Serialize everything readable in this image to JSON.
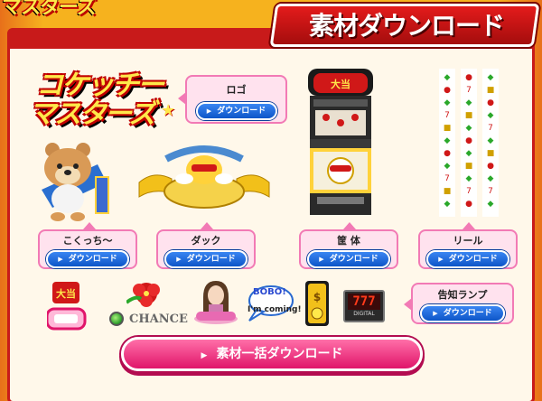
{
  "header": {
    "top_logo_text": "マスターズ",
    "title": "素材ダウンロード"
  },
  "logo_art": {
    "line1": "コケッチー",
    "line2": "マスターズ"
  },
  "download_label": "ダウンロード",
  "items": [
    {
      "label": "ロゴ"
    },
    {
      "label": "こくっち〜"
    },
    {
      "label": "ダック"
    },
    {
      "label": "筐 体"
    },
    {
      "label": "リール"
    },
    {
      "label": "告知ランプ"
    }
  ],
  "small_icons": {
    "chance": "CHANCE",
    "bobo_line1": "BOBO!",
    "bobo_line2": "I'm coming!",
    "digital_counter": "777",
    "digital_label": "DIGITAL"
  },
  "bulk_download_label": "素材一括ダウンロード",
  "colors": {
    "accent_red": "#c81a1a",
    "button_blue": "#0d55c8",
    "bubble_pink": "#ffe2ee",
    "bulk_pink": "#e0156a",
    "background_orange": "#f6b21e"
  }
}
